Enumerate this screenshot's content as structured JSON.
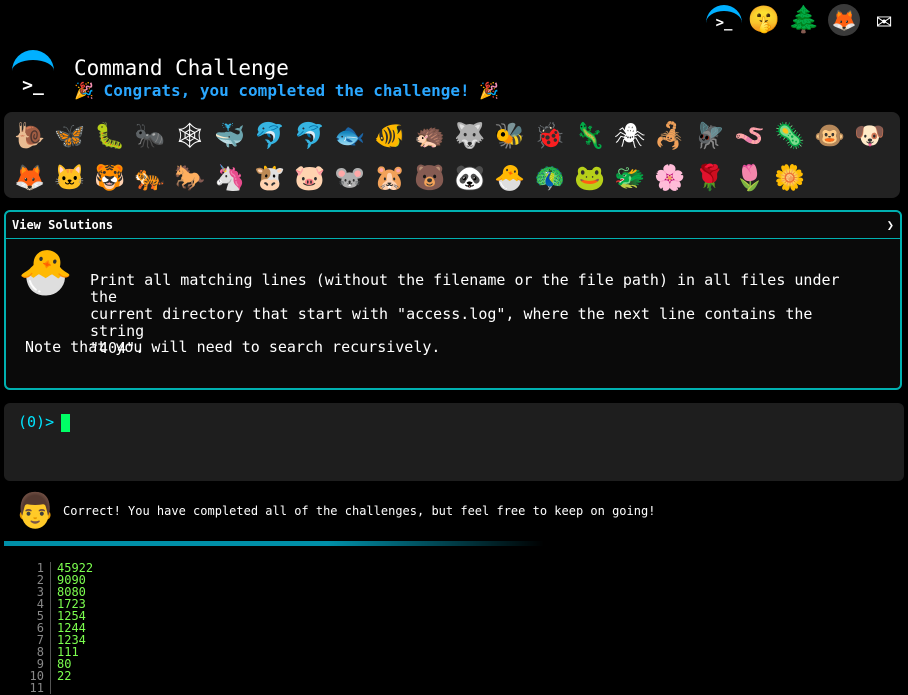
{
  "top_icons": [
    {
      "name": "terminal-logo-icon",
      "glyph": ">_"
    },
    {
      "name": "shushing-face-icon",
      "glyph": "🤫"
    },
    {
      "name": "tree-icon",
      "glyph": "🌲"
    },
    {
      "name": "gitlab-icon",
      "glyph": "🦊"
    },
    {
      "name": "mail-icon",
      "glyph": "✉"
    }
  ],
  "header": {
    "logo_glyph": ">_",
    "title": "Command Challenge",
    "congrats": "🎉 Congrats, you completed the challenge! 🎉"
  },
  "animals_row1": [
    "🐌",
    "🦋",
    "🐛",
    "🐜",
    "🕸",
    "🐳",
    "🐬",
    "🐬",
    "🐟",
    "🐠",
    "🦔",
    "🐺",
    "🐝",
    "🐞",
    "🦎",
    "🕷",
    "🦂",
    "🪰",
    "🪱",
    "🦠",
    "🐵",
    "🐶"
  ],
  "animals_row2": [
    "🦊",
    "🐱",
    "🐯",
    "🐅",
    "🐎",
    "🦄",
    "🐮",
    "🐷",
    "🐭",
    "🐹",
    "🐻",
    "🐼",
    "🐣",
    "🦚",
    "🐸",
    "🐲",
    "🌸",
    "🌹",
    "🌷",
    "🌼"
  ],
  "solutions": {
    "header": "View Solutions",
    "chevron": "❯",
    "chick_glyph": "🐣",
    "description": "Print all matching lines (without the filename or the file path) in all files under the\ncurrent directory that start with \"access.log\", where the next line contains the string\n\"404\".",
    "note": "Note that you will need to search recursively."
  },
  "terminal": {
    "prompt": "(0)>"
  },
  "feedback": {
    "face_glyph": "👨",
    "message": "Correct! You have completed all of the challenges, but feel free to keep on going!"
  },
  "output_lines": [
    {
      "n": "1",
      "v": "45922"
    },
    {
      "n": "2",
      "v": "9090"
    },
    {
      "n": "3",
      "v": "8080"
    },
    {
      "n": "4",
      "v": "1723"
    },
    {
      "n": "5",
      "v": "1254"
    },
    {
      "n": "6",
      "v": "1244"
    },
    {
      "n": "7",
      "v": "1234"
    },
    {
      "n": "8",
      "v": "111"
    },
    {
      "n": "9",
      "v": "80"
    },
    {
      "n": "10",
      "v": "22"
    },
    {
      "n": "11",
      "v": ""
    }
  ]
}
